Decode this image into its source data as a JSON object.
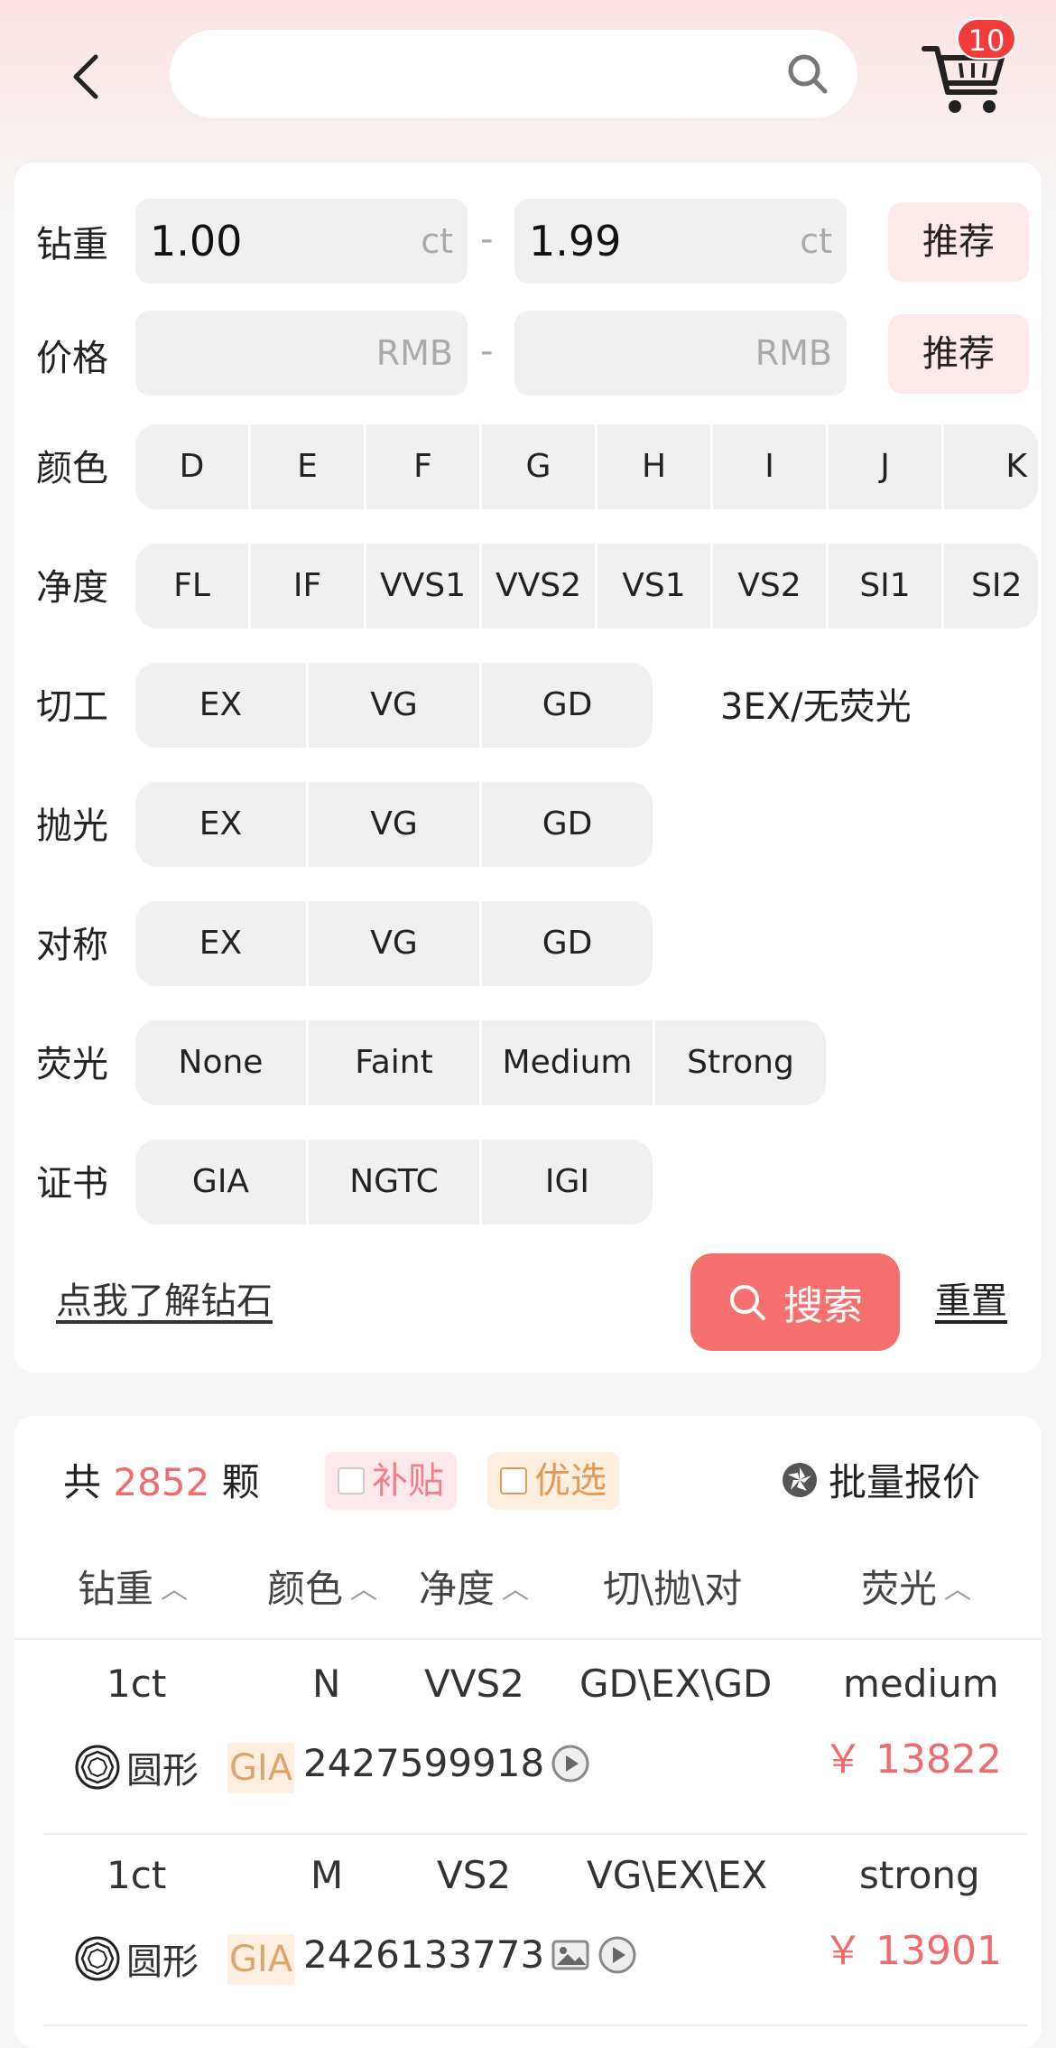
{
  "header": {
    "search_placeholder": "",
    "cart_count": "10"
  },
  "filters": {
    "weight": {
      "label": "钻重",
      "min": "1.00",
      "max": "1.99",
      "unit": "ct",
      "dash": "-",
      "recommend": "推荐"
    },
    "price": {
      "label": "价格",
      "min": "",
      "max": "",
      "unit": "RMB",
      "dash": "-",
      "recommend": "推荐"
    },
    "color": {
      "label": "颜色",
      "options": [
        "D",
        "E",
        "F",
        "G",
        "H",
        "I",
        "J",
        "K"
      ]
    },
    "clarity": {
      "label": "净度",
      "options": [
        "FL",
        "IF",
        "VVS1",
        "VVS2",
        "VS1",
        "VS2",
        "SI1",
        "SI2"
      ]
    },
    "cut": {
      "label": "切工",
      "options": [
        "EX",
        "VG",
        "GD"
      ],
      "extra": "3EX/无荧光"
    },
    "polish": {
      "label": "抛光",
      "options": [
        "EX",
        "VG",
        "GD"
      ]
    },
    "symmetry": {
      "label": "对称",
      "options": [
        "EX",
        "VG",
        "GD"
      ]
    },
    "fluorescence": {
      "label": "荧光",
      "options": [
        "None",
        "Faint",
        "Medium",
        "Strong"
      ]
    },
    "certificate": {
      "label": "证书",
      "options": [
        "GIA",
        "NGTC",
        "IGI"
      ]
    },
    "learn_link": "点我了解钻石",
    "search_button": "搜索",
    "reset_link": "重置"
  },
  "results": {
    "count_prefix": "共",
    "count": "2852",
    "count_suffix": "颗",
    "tag_subsidy": "补贴",
    "tag_preferred": "优选",
    "batch_quote": "批量报价",
    "columns": {
      "weight": "钻重",
      "color": "颜色",
      "clarity": "净度",
      "cut_polish_sym": "切\\抛\\对",
      "fluorescence": "荧光"
    },
    "rows": [
      {
        "weight": "1ct",
        "color": "N",
        "clarity": "VVS2",
        "cps": "GD\\EX\\GD",
        "fluorescence": "medium",
        "shape": "圆形",
        "lab": "GIA",
        "cert_no": "2427599918",
        "price": "￥ 13822"
      },
      {
        "weight": "1ct",
        "color": "M",
        "clarity": "VS2",
        "cps": "VG\\EX\\EX",
        "fluorescence": "strong",
        "shape": "圆形",
        "lab": "GIA",
        "cert_no": "2426133773",
        "price": "￥ 13901"
      }
    ]
  },
  "colors": {
    "accent": "#f77070",
    "price": "#f06b6b",
    "badge": "#f23b3b"
  }
}
